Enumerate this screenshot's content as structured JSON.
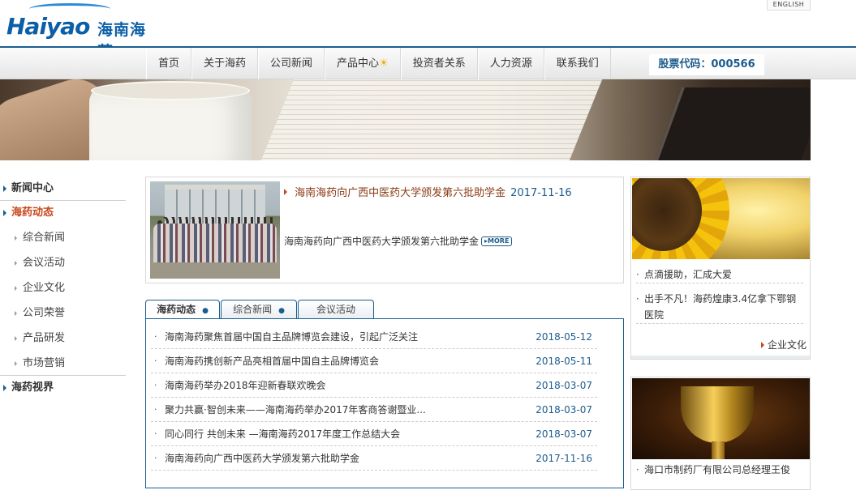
{
  "header": {
    "logo_latin": "Haiyao",
    "logo_cn": "海南海药",
    "lang_button": "ENGLISH"
  },
  "nav": {
    "items": [
      {
        "label": "首页"
      },
      {
        "label": "关于海药"
      },
      {
        "label": "公司新闻"
      },
      {
        "label": "产品中心",
        "icon": "sun-icon"
      },
      {
        "label": "投资者关系"
      },
      {
        "label": "人力资源"
      },
      {
        "label": "联系我们"
      }
    ],
    "stock_label": "股票代码：000566"
  },
  "sidebar": {
    "sections": [
      {
        "label": "新闻中心"
      },
      {
        "label": "海药动态",
        "active": true
      }
    ],
    "sub_items": [
      "综合新闻",
      "会议活动",
      "企业文化",
      "公司荣誉",
      "产品研发",
      "市场营销"
    ],
    "bottom_section": "海药视界"
  },
  "featured": {
    "title": "海南海药向广西中医药大学颁发第六批助学金",
    "date": "2017-11-16",
    "summary": "海南海药向广西中医药大学颁发第六批助学金",
    "more_label": "MORE"
  },
  "tabs": [
    {
      "label": "海药动态",
      "active": true
    },
    {
      "label": "综合新闻"
    },
    {
      "label": "会议活动"
    }
  ],
  "news_list": [
    {
      "title": "海南海药聚焦首届中国自主品牌博览会建设，引起广泛关注",
      "date": "2018-05-12"
    },
    {
      "title": "海南海药携创新产品亮相首届中国自主品牌博览会",
      "date": "2018-05-11"
    },
    {
      "title": "海南海药举办2018年迎新春联欢晚会",
      "date": "2018-03-07"
    },
    {
      "title": "聚力共赢·智创未来——海南海药举办2017年客商答谢暨业...",
      "date": "2018-03-07"
    },
    {
      "title": "同心同行 共创未来 —海南海药2017年度工作总结大会",
      "date": "2018-03-07"
    },
    {
      "title": "海南海药向广西中医药大学颁发第六批助学金",
      "date": "2017-11-16"
    }
  ],
  "right": {
    "card1_items": [
      "点滴援助，汇成大爱",
      "出手不凡！海药煌康3.4亿拿下鄂钢医院"
    ],
    "card1_more": "企业文化",
    "card2_items": [
      "海口市制药厂有限公司总经理王俊"
    ]
  },
  "colors": {
    "brand_blue": "#1a5e8f",
    "accent_orange": "#c8461b",
    "date_blue": "#1d5b8c"
  }
}
